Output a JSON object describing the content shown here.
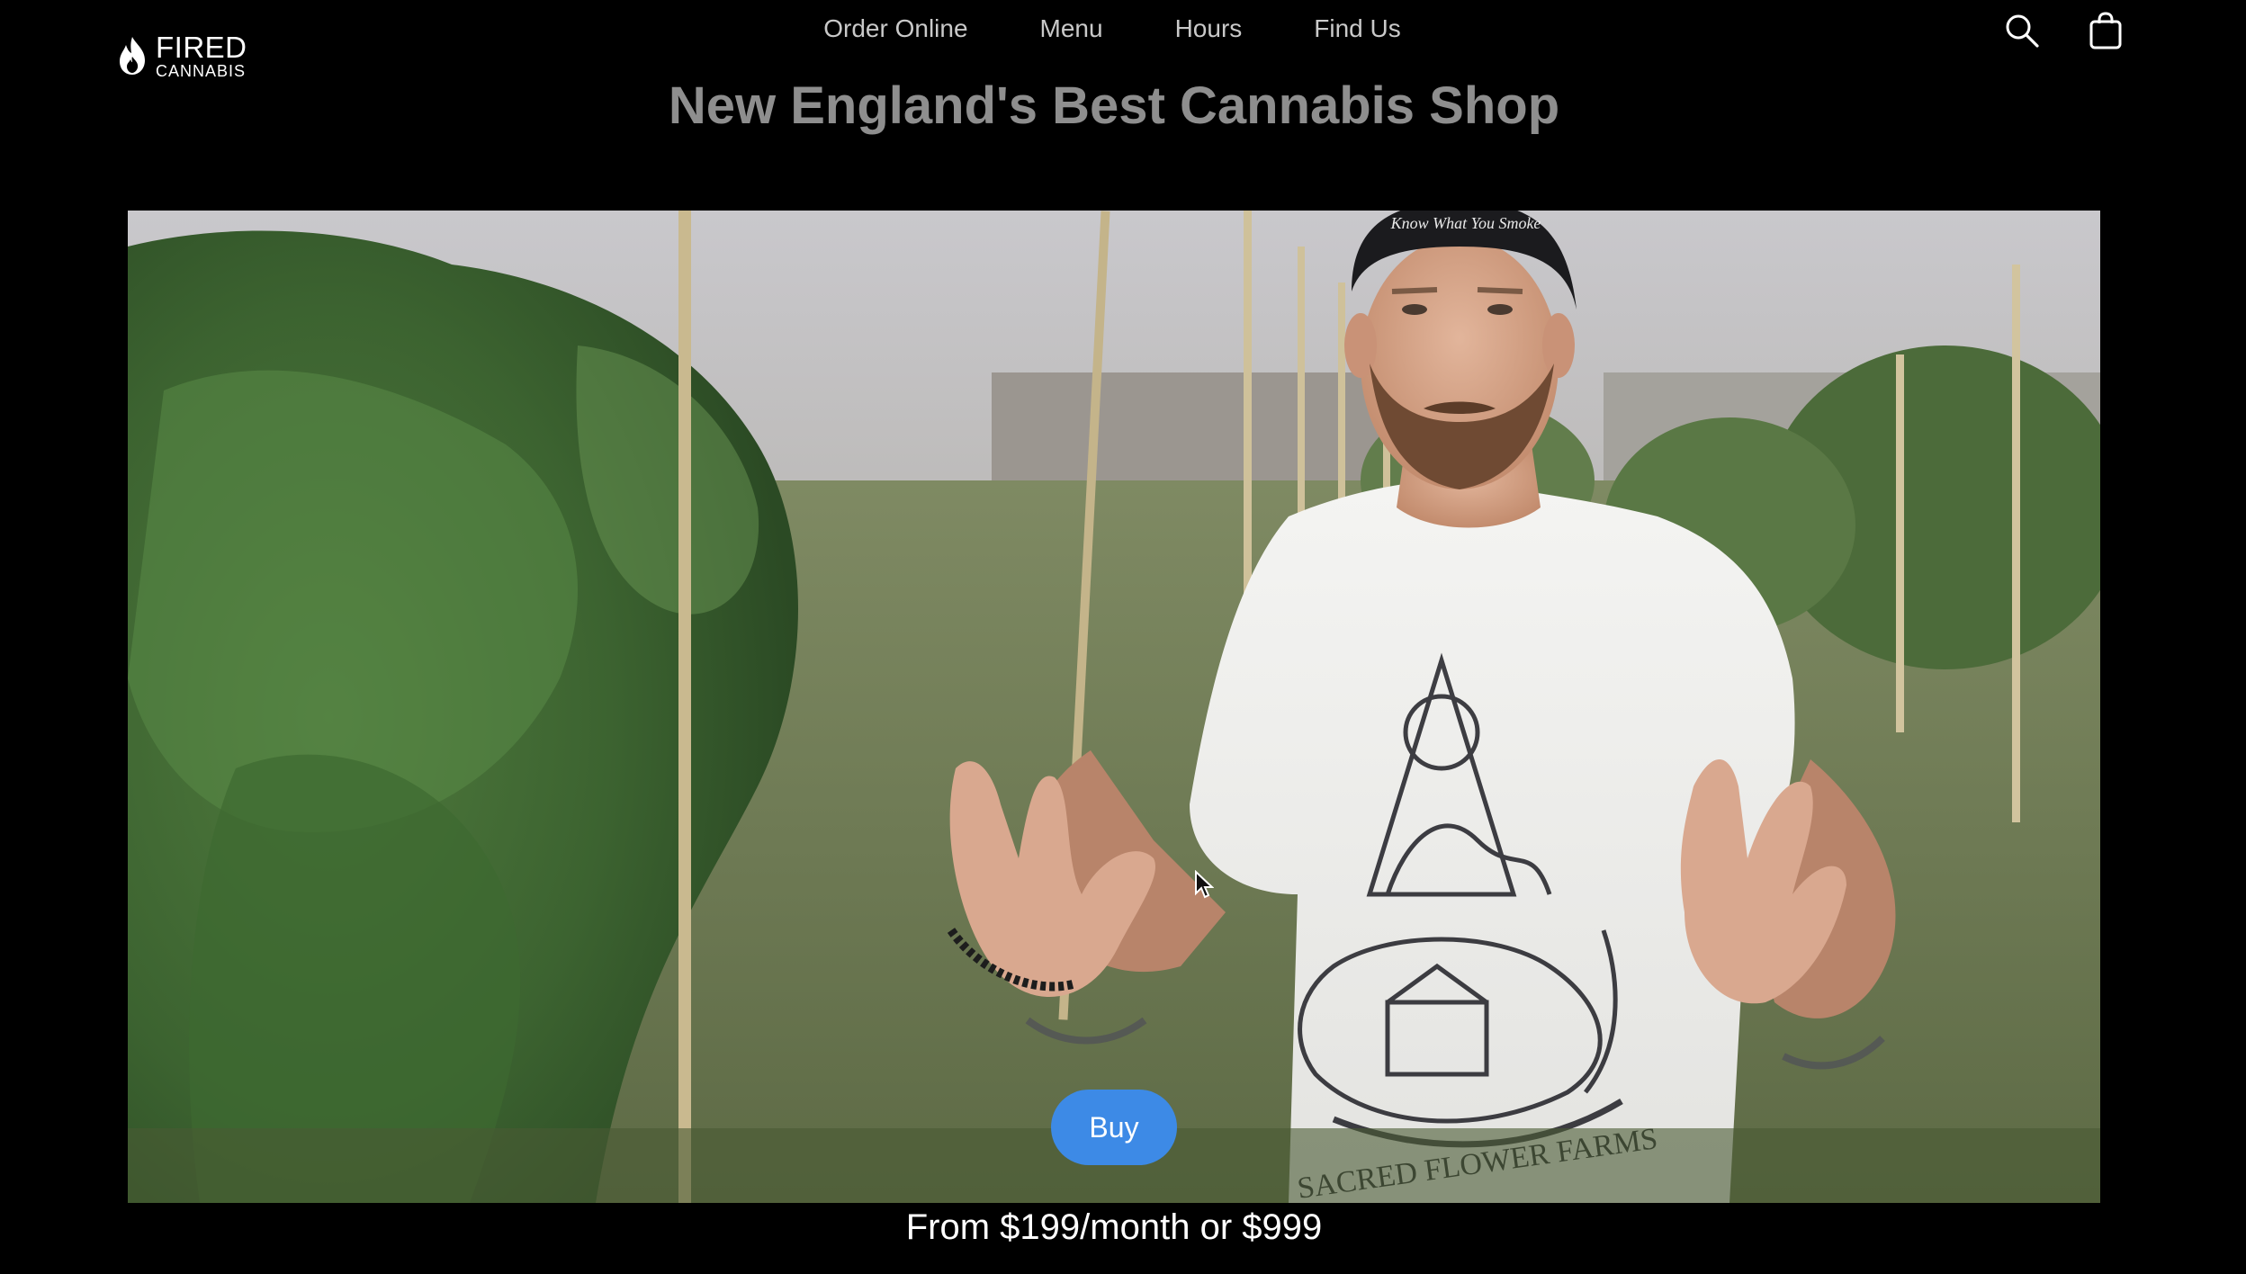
{
  "logo": {
    "word1": "FIRED",
    "word2": "CANNABIS"
  },
  "nav": {
    "items": [
      {
        "label": "Order Online"
      },
      {
        "label": "Menu"
      },
      {
        "label": "Hours"
      },
      {
        "label": "Find Us"
      }
    ]
  },
  "header_icons": {
    "search": "search-icon",
    "bag": "shopping-bag-icon"
  },
  "hero": {
    "title": "New England's Best Cannabis Shop",
    "buy_label": "Buy",
    "price_text": "From $199/month or $999",
    "shirt_text": "SACRED FLOWER FARMS",
    "cap_text": "Know What You Smoke"
  },
  "colors": {
    "background": "#000000",
    "nav_text": "#c9c9c9",
    "title_text": "#8e8e8e",
    "buy_button": "#3d8ae6"
  }
}
